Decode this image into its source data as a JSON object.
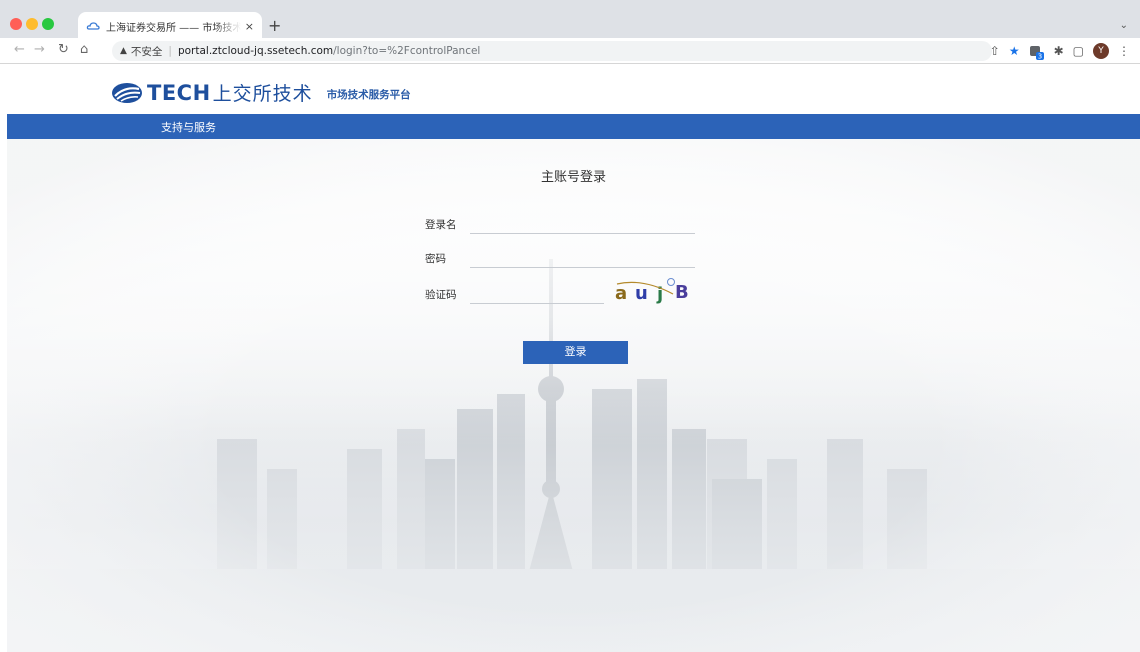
{
  "browser": {
    "tab_title": "上海证券交易所 —— 市场技术服",
    "new_tab": "+",
    "tab_close": "×",
    "tab_menu": "⌄",
    "insecure_label": "不安全",
    "url_host": "portal.ztcloud-jq.ssetech.com",
    "url_path": "/login?to=%2FcontrolPancel",
    "profile_initial": "Y",
    "extension_badge": "3",
    "icons": [
      "back-icon",
      "forward-icon",
      "reload-icon",
      "home-icon",
      "warning-icon",
      "share-icon",
      "bookmark-star-icon",
      "extension-icon",
      "puzzle-icon",
      "sidepanel-icon",
      "profile-icon",
      "menu-icon"
    ]
  },
  "header": {
    "logo_latin": "TECH",
    "logo_cn": "上交所技术",
    "subtitle": "市场技术服务平台"
  },
  "nav": {
    "items": [
      "支持与服务"
    ]
  },
  "login": {
    "title": "主账号登录",
    "username_label": "登录名",
    "password_label": "密码",
    "captcha_label": "验证码",
    "captcha_text": "a u j B",
    "username_value": "",
    "password_value": "",
    "captcha_value": "",
    "submit_label": "登录"
  },
  "colors": {
    "brand_blue": "#2c63b8",
    "logo_blue": "#1e4f9d"
  }
}
